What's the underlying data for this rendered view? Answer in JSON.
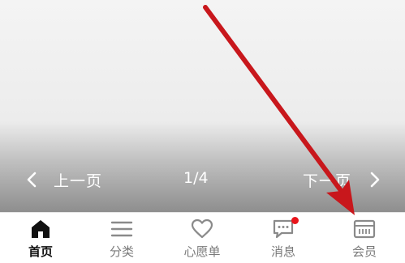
{
  "pager": {
    "prev_label": "上一页",
    "page_indicator": "1/4",
    "next_label": "下一页"
  },
  "tabs": [
    {
      "label": "首页",
      "icon": "home-icon",
      "active": true
    },
    {
      "label": "分类",
      "icon": "menu-icon",
      "active": false
    },
    {
      "label": "心愿单",
      "icon": "heart-icon",
      "active": false
    },
    {
      "label": "消息",
      "icon": "message-icon",
      "active": false,
      "badge": true
    },
    {
      "label": "会员",
      "icon": "member-card-icon",
      "active": false
    }
  ],
  "colors": {
    "annotation_arrow": "#c8171c",
    "badge": "#e8141b",
    "active_tab": "#111111",
    "inactive_tab": "#7a7a7a"
  }
}
